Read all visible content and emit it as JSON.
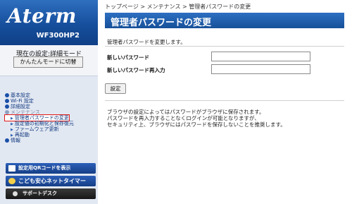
{
  "sidebar": {
    "logo": "Aterm",
    "model": "WF300HP2",
    "current_mode": "現在の設定:詳細モード",
    "simple_mode_button": "かんたんモードに切替",
    "menu": [
      {
        "label": "基本設定",
        "level": 0
      },
      {
        "label": "Wi-Fi 設定",
        "level": 0
      },
      {
        "label": "詳細設定",
        "level": 0
      },
      {
        "label": "メンテナンス",
        "level": 0
      },
      {
        "label": "管理者パスワードの変更",
        "level": 1
      },
      {
        "label": "設定値の初期化と保存復元",
        "level": 1
      },
      {
        "label": "ファームウェア更新",
        "level": 1
      },
      {
        "label": "再起動",
        "level": 1
      },
      {
        "label": "情報",
        "level": 0
      }
    ],
    "qr_button": "設定用QRコードを表示",
    "kids_timer_button": "こども安心ネットタイマー",
    "support_button": "サポートデスク"
  },
  "breadcrumb": "トップページ > メンテナンス > 管理者パスワードの変更",
  "page_title": "管理者パスワードの変更",
  "description": "管理者パスワードを変更します。",
  "form": {
    "new_password_label": "新しいパスワード",
    "new_password_value": "",
    "retype_label": "新しいパスワード再入力",
    "retype_value": "",
    "submit_label": "設定"
  },
  "notes": [
    "ブラウザの設定によってはパスワードがブラウザに保存されます。",
    "パスワードを再入力することなくログインが可能となりますが、",
    "セキュリティ上、ブラウザにはパスワードを保存しないことを推奨します。"
  ],
  "colors": {
    "accent_blue": "#175099",
    "sidebar_bg": "#e2e8f2",
    "active_outline": "#e01818"
  }
}
